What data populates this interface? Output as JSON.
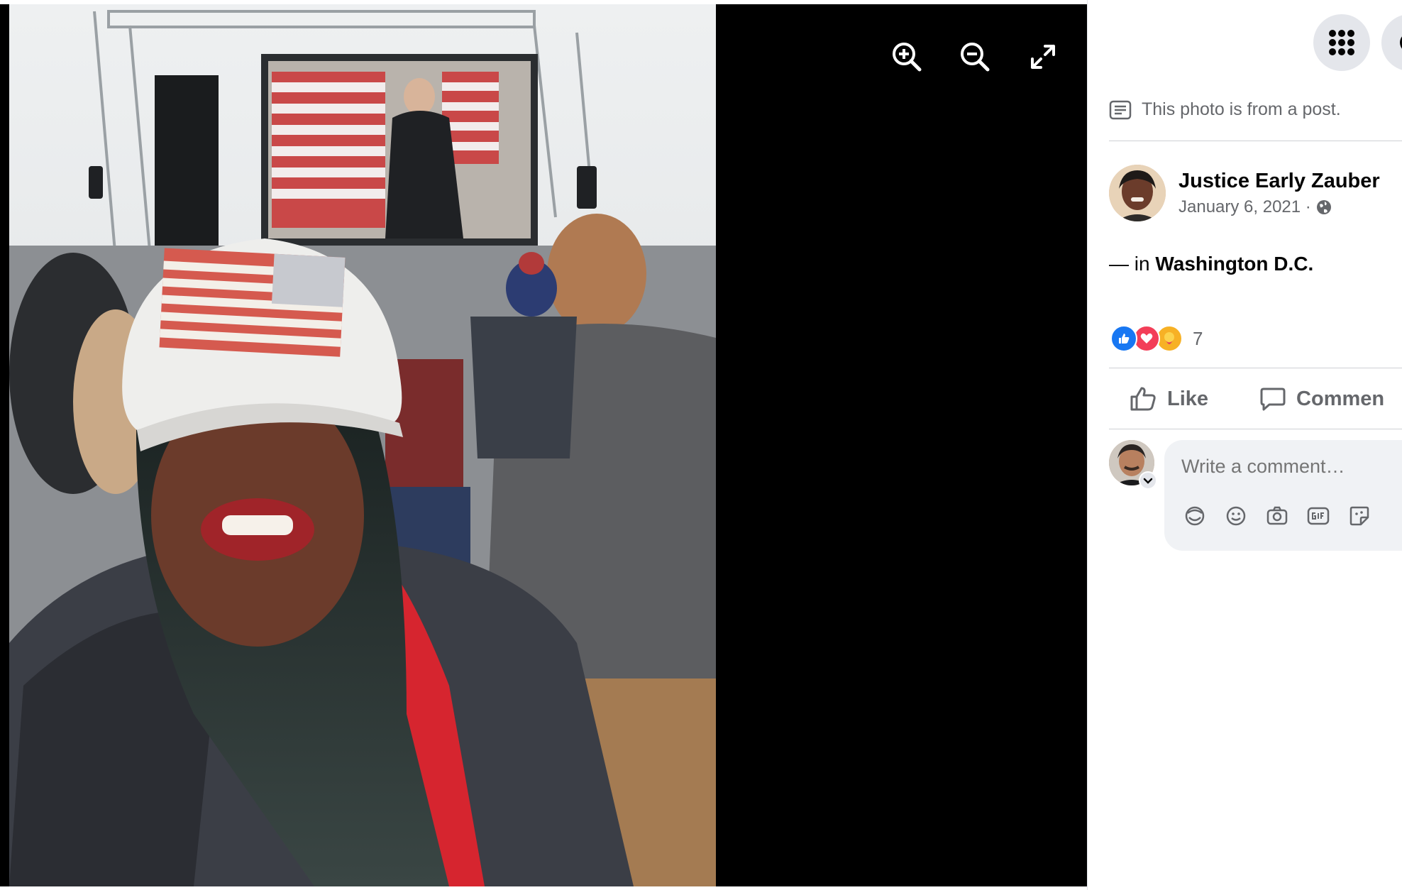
{
  "viewer": {
    "photo_description_icon": "photo",
    "zoom_in_icon": "zoom-in-icon",
    "zoom_out_icon": "zoom-out-icon",
    "fullscreen_icon": "expand-icon"
  },
  "topbar": {
    "menu_icon": "grid-menu-icon",
    "account_icon": "account-icon"
  },
  "post": {
    "source_note": "This photo is from a post.",
    "author_name": "Justice Early Zauber",
    "date": "January 6, 2021 ·",
    "privacy_icon": "globe-icon",
    "location_prefix": "— in",
    "location": "Washington D.C.",
    "reaction_count": "7",
    "reactions": [
      "like",
      "love",
      "care"
    ]
  },
  "actions": {
    "like_label": "Like",
    "comment_label": "Commen"
  },
  "comment": {
    "placeholder": "Write a comment…",
    "tools": [
      "avatar-sticker-icon",
      "emoji-icon",
      "camera-icon",
      "gif-icon",
      "sticker-icon"
    ]
  },
  "colors": {
    "brand_blue": "#1877f2",
    "love_red": "#f33e58",
    "care_yellow": "#f7b125",
    "secondary_text": "#65676b"
  }
}
